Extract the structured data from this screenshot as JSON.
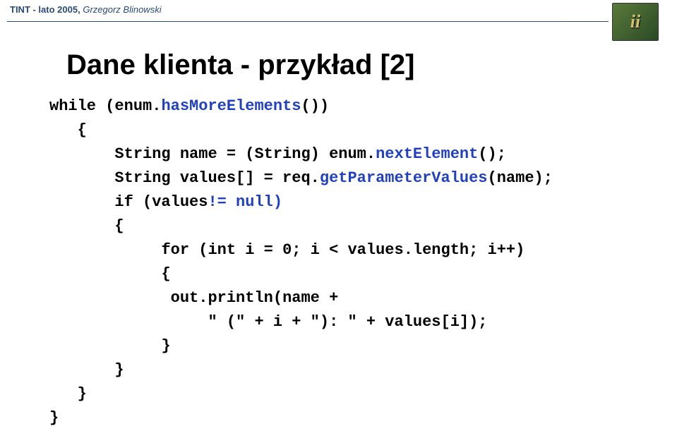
{
  "header": {
    "course": "TINT - lato 2005,",
    "author": "Grzegorz Blinowski"
  },
  "logo": {
    "text": "ii"
  },
  "title": "Dane klienta - przykład [2]",
  "code": {
    "l1a": "while (enum.",
    "l1b": "hasMoreElements",
    "l1c": "())",
    "l2": "{",
    "l3a": "String name = (String) enum.",
    "l3b": "nextElement",
    "l3c": "();",
    "l4a": "String values[] = req.",
    "l4b": "getParameterValues",
    "l4c": "(name);",
    "l5a": "if (values",
    "l5b": "!= null)",
    "l6": "{",
    "l7": "for (int i = 0; i < values.length; i++)",
    "l8": "{",
    "l9": "out.println(name +",
    "l10": "\" (\" + i + \"): \" + values[i]);",
    "l11": "}",
    "l12": "}",
    "l13": "}",
    "l14": "}"
  }
}
